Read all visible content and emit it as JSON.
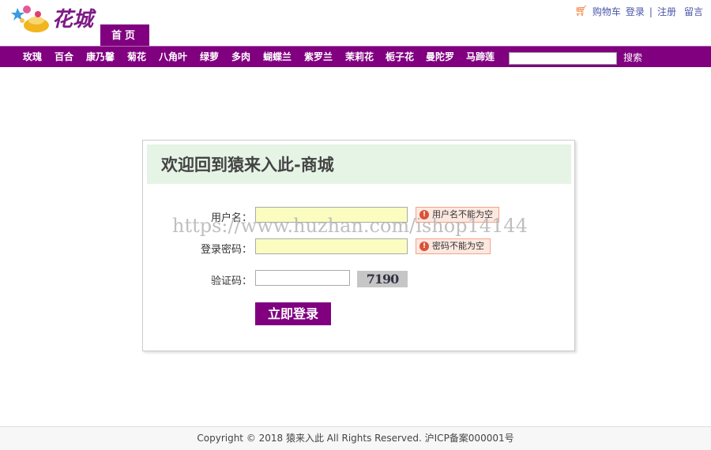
{
  "header": {
    "logo_text": "花城",
    "home_tab": "首页",
    "links": {
      "cart": "购物车",
      "login": "登录",
      "sep": "|",
      "register": "注册",
      "message": "留言"
    }
  },
  "nav": {
    "items": [
      "玫瑰",
      "百合",
      "康乃馨",
      "菊花",
      "八角叶",
      "绿萝",
      "多肉",
      "蝴蝶兰",
      "紫罗兰",
      "茉莉花",
      "栀子花",
      "曼陀罗",
      "马蹄莲"
    ],
    "search_value": "",
    "search_label": "搜索"
  },
  "login": {
    "title": "欢迎回到猿来入此-商城",
    "username_label": "用户名：",
    "username_value": "",
    "username_error": "用户名不能为空",
    "password_label": "登录密码：",
    "password_value": "",
    "password_error": "密码不能为空",
    "captcha_label": "验证码：",
    "captcha_value": "",
    "captcha_image_text": "7190",
    "submit": "立即登录"
  },
  "watermark": "https://www.huzhan.com/ishop14144",
  "footer": {
    "text": "Copyright © 2018 猿来入此 All Rights Reserved. 沪ICP备案000001号"
  },
  "colors": {
    "brand": "#800080",
    "header_bg": "#e6f4e6",
    "field_bg": "#fbfdc0",
    "error_bg": "#fde8e0"
  }
}
